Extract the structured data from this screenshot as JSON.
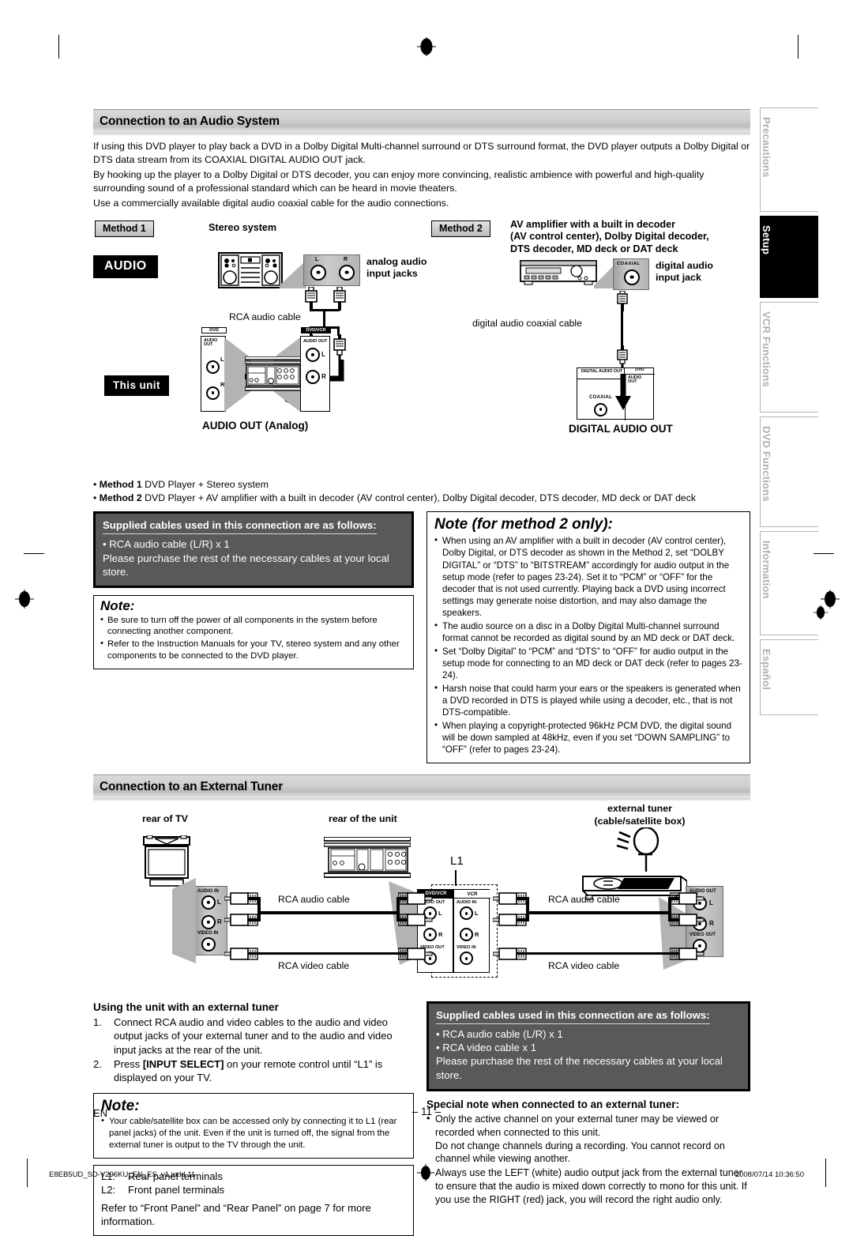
{
  "page": {
    "lang_code": "EN",
    "page_number": "– 11 –",
    "imprint": "E8EB5UD_SD-V296KU_EN_ES_v1.indd   11",
    "timestamp": "2008/07/14   10:36:50"
  },
  "tabs": [
    {
      "label": "Precautions",
      "active": false
    },
    {
      "label": "Setup",
      "active": true
    },
    {
      "label": "VCR Functions",
      "active": false
    },
    {
      "label": "DVD Functions",
      "active": false
    },
    {
      "label": "Information",
      "active": false
    },
    {
      "label": "Español",
      "active": false
    }
  ],
  "audio_section": {
    "heading": "Connection to an Audio System",
    "paragraphs": [
      "If using this DVD player to play back a DVD in a Dolby Digital Multi-channel surround or DTS surround format, the DVD player outputs a Dolby Digital or DTS data stream from its COAXIAL DIGITAL AUDIO OUT jack.",
      "By hooking up the player to a Dolby Digital or DTS decoder, you can enjoy more convincing, realistic ambience with powerful and high-quality surrounding sound of a professional standard which can be heard in movie theaters.",
      "Use a commercially available digital audio coaxial cable for the audio connections."
    ],
    "method1": {
      "tag": "Method 1",
      "title": "Stereo system",
      "badge": "AUDIO",
      "jack_label": "analog audio\ninput jacks",
      "jack_label_l1": "analog audio",
      "jack_label_l2": "input jacks",
      "cable_label": "RCA audio cable",
      "jack_L": "L",
      "jack_R": "R"
    },
    "method2": {
      "tag": "Method 2",
      "title_lines": [
        "AV amplifier with a built in decoder",
        "(AV control center), Dolby Digital decoder,",
        "DTS decoder, MD deck or DAT deck"
      ],
      "jack_label_l1": "digital audio",
      "jack_label_l2": "input jack",
      "jack_tag": "COAXIAL",
      "cable_label": "digital audio coaxial cable"
    },
    "this_unit": {
      "badge": "This unit",
      "left_panel": {
        "header": "DVD",
        "port": "AUDIO OUT",
        "jack_L": "L",
        "jack_R": "R"
      },
      "right_panel": {
        "header": "DVD/VCR",
        "port": "AUDIO OUT",
        "jack_L": "L",
        "jack_R": "R"
      },
      "caption": "AUDIO OUT (Analog)",
      "digital_panel": {
        "header_left": "DIGITAL AUDIO OUT",
        "header_right": "DVD",
        "port_right": "AUDIO OUT",
        "coaxial": "COAXIAL"
      },
      "digital_caption": "DIGITAL AUDIO OUT"
    },
    "summary": [
      {
        "bold": "Method 1",
        "text": "DVD Player + Stereo system"
      },
      {
        "bold": "Method 2",
        "text": "DVD Player + AV amplifier with a built in decoder (AV control center), Dolby Digital decoder, DTS decoder, MD deck or DAT deck"
      }
    ],
    "supplied": {
      "heading": "Supplied cables used in this connection are as follows:",
      "items": [
        "• RCA audio cable (L/R) x 1"
      ],
      "footer": "Please purchase the rest of the necessary cables at your local store."
    },
    "note": {
      "title": "Note:",
      "items": [
        "Be sure to turn off the power of all components in the system before connecting another component.",
        "Refer to the Instruction Manuals for your TV, stereo system and any other components to be connected to the DVD player."
      ]
    },
    "note_method2": {
      "title": "Note (for method 2 only):",
      "items": [
        "When using an AV amplifier with a built in decoder (AV control center), Dolby Digital, or DTS decoder as shown in the Method 2, set “DOLBY DIGITAL” or “DTS” to “BITSTREAM” accordingly for audio output in the setup mode (refer to pages 23-24). Set it to “PCM” or “OFF” for the decoder that is not used currently. Playing back a DVD using incorrect settings may generate noise distortion, and may also damage the speakers.",
        "The audio source on a disc in a Dolby Digital Multi-channel surround format cannot be recorded as digital sound by an MD deck or DAT deck.",
        "Set “Dolby Digital” to “PCM” and “DTS” to “OFF” for audio output in the setup mode for connecting to an MD deck or DAT deck (refer to pages 23-24).",
        "Harsh noise that could harm your ears or the speakers is generated when a DVD recorded in DTS is played while using a decoder, etc., that is not DTS-compatible.",
        "When playing a copyright-protected 96kHz PCM DVD, the digital sound will be down sampled at 48kHz, even if you set “DOWN SAMPLING” to “OFF” (refer to pages 23-24)."
      ]
    }
  },
  "tuner_section": {
    "heading": "Connection to an External Tuner",
    "labels": {
      "rear_of_tv": "rear of TV",
      "rear_of_unit": "rear of the unit",
      "external_tuner_l1": "external tuner",
      "external_tuner_l2": "(cable/satellite box)",
      "l1_marker": "L1"
    },
    "tv_panel": {
      "audio_in": "AUDIO IN",
      "video_in": "VIDEO IN",
      "jack_L": "L",
      "jack_R": "R"
    },
    "unit_panel": {
      "left_header": "DVD/VCR",
      "left_audio_out": "AUDIO OUT",
      "left_video_out": "VIDEO OUT",
      "right_header": "VCR",
      "right_audio_in": "AUDIO IN",
      "right_video_in": "VIDEO IN",
      "jack_L": "L",
      "jack_R": "R"
    },
    "tuner_panel": {
      "audio_out": "AUDIO OUT",
      "video_out": "VIDEO OUT",
      "jack_L": "L",
      "jack_R": "R"
    },
    "cables": {
      "audio_left": "RCA audio cable",
      "video_left": "RCA video cable",
      "audio_right": "RCA audio cable",
      "video_right": "RCA video cable"
    },
    "using": {
      "heading": "Using the unit with an external tuner",
      "steps": [
        {
          "n": "1.",
          "pre": "Connect RCA audio and video cables to the audio and video output jacks of your external tuner and to the audio and video input jacks at the rear of the unit.",
          "bold": "",
          "post": ""
        },
        {
          "n": "2.",
          "pre": "Press ",
          "bold": "[INPUT SELECT]",
          "post": " on your remote control until “L1” is displayed on your TV."
        }
      ]
    },
    "note": {
      "title": "Note:",
      "items": [
        "Your cable/satellite box can be accessed only by connecting it to L1 (rear panel jacks) of the unit. Even if the unit is turned off, the signal from the external tuner is output to the TV through the unit."
      ]
    },
    "terminals": {
      "rows": [
        {
          "k": "L1:",
          "v": "Rear panel terminals"
        },
        {
          "k": "L2:",
          "v": "Front panel terminals"
        }
      ],
      "footer": "Refer to “Front Panel” and “Rear Panel” on page 7 for more information."
    },
    "supplied": {
      "heading": "Supplied cables used in this connection are as follows:",
      "items": [
        "• RCA audio cable (L/R) x 1",
        "• RCA video cable x 1"
      ],
      "footer": "Please purchase the rest of the necessary cables at your local store."
    },
    "special_note": {
      "heading": "Special note when connected to an external tuner:",
      "items": [
        {
          "text": "Only the active channel on your external tuner may be viewed or recorded when connected to this unit.",
          "cont": "Do not change channels during a recording. You cannot record on channel while viewing another."
        },
        {
          "text": "Always use the LEFT (white) audio output jack from the external tuner to ensure that the audio is mixed down correctly to mono for this unit. If you use the RIGHT (red) jack, you will record the right audio only.",
          "cont": ""
        }
      ]
    }
  }
}
